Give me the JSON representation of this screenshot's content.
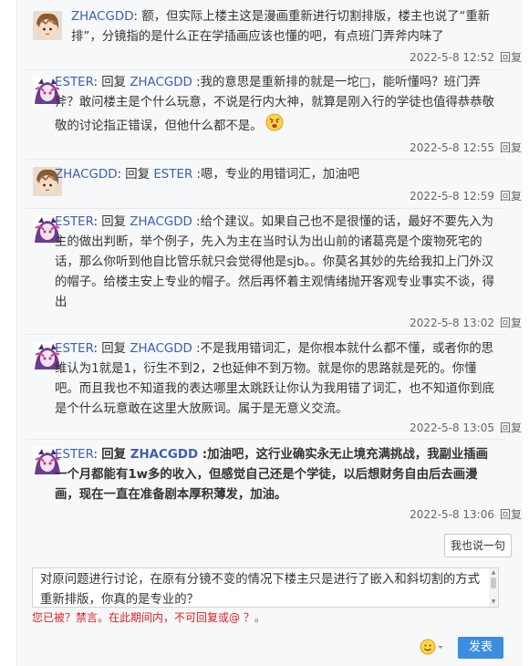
{
  "replies": [
    {
      "user": "ZHACGDD",
      "prefix": "",
      "target": "",
      "content": "额，但实际上楼主这是漫画重新进行切割排版，楼主也说了“重新排”，分镜指的是什么正在学插画应该也懂的吧，有点班门弄斧内味了",
      "time": "2022-5-8 12:52",
      "reply_label": "回复",
      "avatar": "zhacgdd-avatar",
      "emoji": ""
    },
    {
      "user": "ESTER",
      "prefix": ": 回复 ",
      "target": "ZHACGDD",
      "content": " :我的意思是重新排的就是一坨□，能听懂吗？班门弄斧？敢问楼主是个什么玩意，不说是行内大神，就算是刚入行的学徒也值得恭恭敬敬的讨论指正错误，但他什么都不是。",
      "time": "2022-5-8 12:55",
      "reply_label": "回复",
      "avatar": "ester-avatar",
      "emoji": "angry-face"
    },
    {
      "user": "ZHACGDD",
      "prefix": ": 回复 ",
      "target": "ESTER",
      "content": " :嗯，专业的用错词汇，加油吧",
      "time": "2022-5-8 12:59",
      "reply_label": "回复",
      "avatar": "zhacgdd-avatar",
      "emoji": ""
    },
    {
      "user": "ESTER",
      "prefix": ": 回复 ",
      "target": "ZHACGDD",
      "content": " :给个建议。如果自己也不是很懂的话，最好不要先入为主的做出判断，举个例子，先入为主在当时认为出山前的诸葛亮是个废物死宅的话，那么你听到他自比管乐就只会觉得他是sjb。。你莫名其妙的先给我扣上门外汉的帽子。给楼主安上专业的帽子。然后再怀着主观情绪抛开客观专业事实不谈，得出",
      "time": "2022-5-8 13:02",
      "reply_label": "回复",
      "avatar": "ester-avatar",
      "emoji": ""
    },
    {
      "user": "ESTER",
      "prefix": ": 回复 ",
      "target": "ZHACGDD",
      "content": " :不是我用错词汇，是你根本就什么都不懂，或者你的思维认为1就是1，衍生不到2，2也延伸不到万物。就是你的思路就是死的。你懂吧。而且我也不知道我的表达哪里太跳跃让你认为我用错了词汇，也不知道你到底是个什么玩意敢在这里大放厥词。属于是无意义交流。",
      "time": "2022-5-8 13:05",
      "reply_label": "回复",
      "avatar": "ester-avatar",
      "emoji": ""
    },
    {
      "user": "ESTER",
      "prefix": ": 回复 ",
      "target": "ZHACGDD",
      "content": " :加油吧，这行业确实永无止境充满挑战，我副业插画一个月都能有1w多的收入，但感觉自己还是个学徒，以后想财务自由后去画漫画，现在一直在准备剧本厚积薄发，加油。",
      "time": "2022-5-8 13:06",
      "reply_label": "回复",
      "avatar": "ester-avatar",
      "emoji": ""
    }
  ],
  "say_button": "我也说一句",
  "editor_text": "对原问题进行讨论，在原有分镜不变的情况下楼主只是进行了嵌入和斜切割的方式重新排版，你真的是专业的？",
  "notice": "您已被？禁言。在此期间内，不可回复或@ ？。",
  "submit_label": "发表",
  "emoji_icon": "smiley-face-icon",
  "colors": {
    "link": "#3e5fb0",
    "submit_bg": "#3c8ce0",
    "notice": "#e02020",
    "panel_bg": "#f7f8fa"
  }
}
